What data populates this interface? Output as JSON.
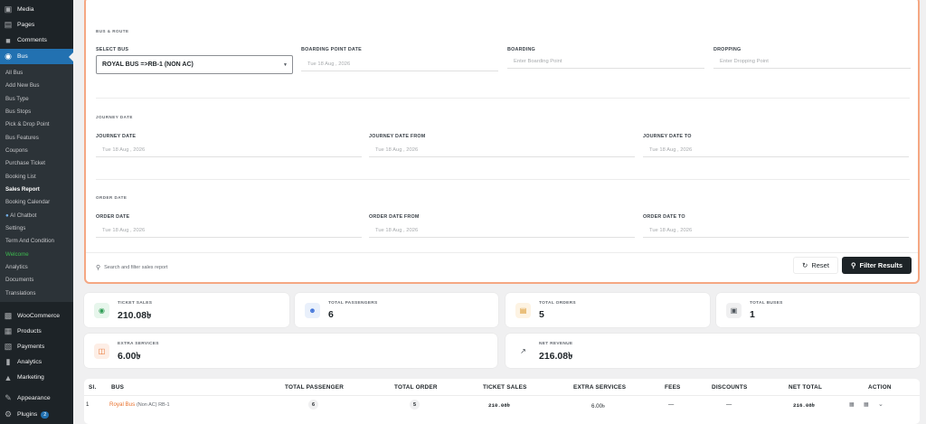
{
  "sidebar": {
    "items": [
      {
        "label": "Media",
        "icon": "media-icon"
      },
      {
        "label": "Pages",
        "icon": "pages-icon"
      },
      {
        "label": "Comments",
        "icon": "comments-icon"
      },
      {
        "label": "Bus",
        "icon": "bus-icon"
      },
      {
        "label": "WooCommerce",
        "icon": "woocommerce-icon"
      },
      {
        "label": "Products",
        "icon": "products-icon"
      },
      {
        "label": "Payments",
        "icon": "payments-icon"
      },
      {
        "label": "Analytics",
        "icon": "analytics-icon"
      },
      {
        "label": "Marketing",
        "icon": "marketing-icon"
      },
      {
        "label": "Appearance",
        "icon": "appearance-icon"
      },
      {
        "label": "Plugins",
        "icon": "plugins-icon",
        "badge": "2"
      }
    ],
    "submenu": [
      "All Bus",
      "Add New Bus",
      "Bus Type",
      "Bus Stops",
      "Pick & Drop Point",
      "Bus Features",
      "Coupons",
      "Purchase Ticket",
      "Booking List",
      "Sales Report",
      "Booking Calendar",
      "AI Chatbot",
      "Settings",
      "Term And Condition",
      "Welcome",
      "Analytics",
      "Documents",
      "Translations"
    ]
  },
  "filters": {
    "section_bus": "BUS & ROUTE",
    "select_bus_label": "SELECT BUS",
    "select_bus_value": "ROYAL BUS =>RB-1 (NON AC)",
    "boarding_date_label": "BOARDING POINT DATE",
    "boarding_date_value": "Tue 18 Aug , 2026",
    "boarding_label": "BOARDING",
    "boarding_placeholder": "Enter Boarding Point",
    "dropping_label": "DROPPING",
    "dropping_placeholder": "Enter Dropping Point",
    "section_journey": "JOURNEY DATE",
    "journey_date_label": "JOURNEY DATE",
    "journey_date_value": "Tue 18 Aug , 2026",
    "journey_from_label": "JOURNEY DATE FROM",
    "journey_from_value": "Tue 18 Aug , 2026",
    "journey_to_label": "JOURNEY DATE TO",
    "journey_to_value": "Tue 18 Aug , 2026",
    "section_order": "ORDER DATE",
    "order_date_label": "ORDER DATE",
    "order_date_value": "Tue 18 Aug , 2026",
    "order_from_label": "ORDER DATE FROM",
    "order_from_value": "Tue 18 Aug , 2026",
    "order_to_label": "ORDER DATE TO",
    "order_to_value": "Tue 18 Aug , 2026",
    "hint": "Search and filter sales report",
    "reset_label": "Reset",
    "filter_label": "Filter Results"
  },
  "stats": {
    "ticket_sales": {
      "title": "TICKET SALES",
      "value": "210.08৳"
    },
    "total_passengers": {
      "title": "TOTAL PASSENGERS",
      "value": "6"
    },
    "total_orders": {
      "title": "TOTAL ORDERS",
      "value": "5"
    },
    "total_buses": {
      "title": "TOTAL BUSES",
      "value": "1"
    },
    "extra_services": {
      "title": "EXTRA SERVICES",
      "value": "6.00৳"
    },
    "net_revenue": {
      "title": "NET REVENUE",
      "value": "216.08৳"
    }
  },
  "table": {
    "headers": {
      "sl": "Sl.",
      "bus": "BUS",
      "passenger": "TOTAL PASSENGER",
      "order": "TOTAL ORDER",
      "sales": "TICKET SALES",
      "extra": "EXTRA SERVICES",
      "fees": "FEES",
      "discounts": "DISCOUNTS",
      "net": "NET TOTAL",
      "action": "ACTION"
    },
    "row": {
      "sl": "1",
      "bus_name": "Royal Bus",
      "bus_meta": "(Non AC) RB-1",
      "passenger": "6",
      "order": "5",
      "sales": "210.08৳",
      "extra": "6.00৳",
      "fees": "—",
      "discounts": "—",
      "net": "216.08৳"
    }
  },
  "colors": {
    "accent": "#2271b1",
    "panel_border": "#f5a783",
    "bus_link": "#e8712d",
    "welcome": "#3dbb4f"
  }
}
